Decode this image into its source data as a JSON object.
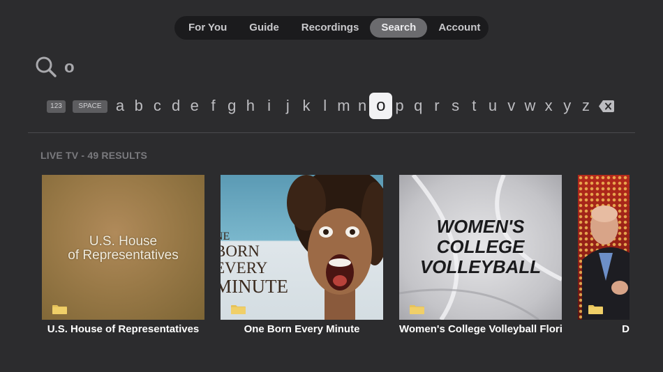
{
  "nav": {
    "tabs": [
      {
        "label": "For You"
      },
      {
        "label": "Guide"
      },
      {
        "label": "Recordings"
      },
      {
        "label": "Search",
        "active": true
      },
      {
        "label": "Account"
      }
    ]
  },
  "search": {
    "query": "o",
    "icon": "search-icon"
  },
  "keyboard": {
    "numbers_key": "123",
    "space_key": "SPACE",
    "letters": [
      "a",
      "b",
      "c",
      "d",
      "e",
      "f",
      "g",
      "h",
      "i",
      "j",
      "k",
      "l",
      "m",
      "n",
      "o",
      "p",
      "q",
      "r",
      "s",
      "t",
      "u",
      "v",
      "w",
      "x",
      "y",
      "z"
    ],
    "focused_letter": "o",
    "backspace_icon": "backspace-icon"
  },
  "results": {
    "section_label": "LIVE TV - 49 RESULTS",
    "items": [
      {
        "title": "U.S. House of Representatives",
        "art_text": [
          "U.S. House",
          "of Representatives"
        ]
      },
      {
        "title": "One Born Every Minute",
        "art_text": [
          "NE",
          "BORN",
          "EVERY",
          "MINUTE"
        ]
      },
      {
        "title": "Women's College Volleyball Flori...",
        "art_text": [
          "WOMEN'S",
          "COLLEGE",
          "VOLLEYBALL"
        ]
      },
      {
        "title": "D"
      }
    ]
  },
  "colors": {
    "background": "#2c2c2e",
    "nav_bar": "#1b1b1d",
    "active_tab": "#6b6b6e",
    "focused_key": "#f2f2f4"
  }
}
